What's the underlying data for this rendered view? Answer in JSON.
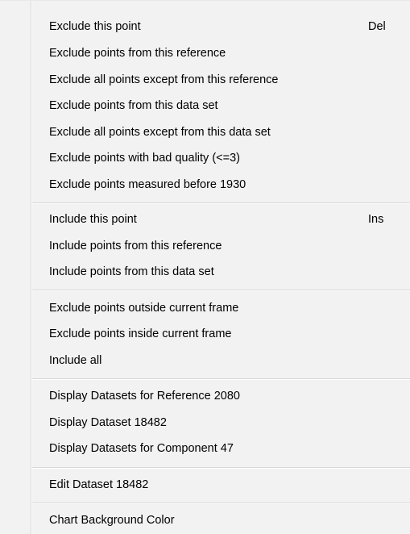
{
  "menu": {
    "groups": [
      {
        "items": [
          {
            "label": "Exclude this point",
            "shortcut": "Del"
          },
          {
            "label": "Exclude points from this reference"
          },
          {
            "label": "Exclude all points except from this reference"
          },
          {
            "label": "Exclude points from this data set"
          },
          {
            "label": "Exclude all points except from this data set"
          },
          {
            "label": "Exclude points with bad quality (<=3)"
          },
          {
            "label": "Exclude points measured before 1930"
          }
        ]
      },
      {
        "items": [
          {
            "label": "Include this point",
            "shortcut": "Ins"
          },
          {
            "label": "Include points from this reference"
          },
          {
            "label": "Include points from this data set"
          }
        ]
      },
      {
        "items": [
          {
            "label": "Exclude points outside current frame"
          },
          {
            "label": "Exclude points inside current frame"
          },
          {
            "label": "Include all"
          }
        ]
      },
      {
        "items": [
          {
            "label": "Display Datasets for Reference 2080"
          },
          {
            "label": "Display Dataset 18482"
          },
          {
            "label": "Display Datasets for Component 47"
          }
        ]
      },
      {
        "items": [
          {
            "label": "Edit Dataset 18482"
          }
        ]
      },
      {
        "items": [
          {
            "label": "Chart Background Color"
          }
        ]
      }
    ]
  }
}
